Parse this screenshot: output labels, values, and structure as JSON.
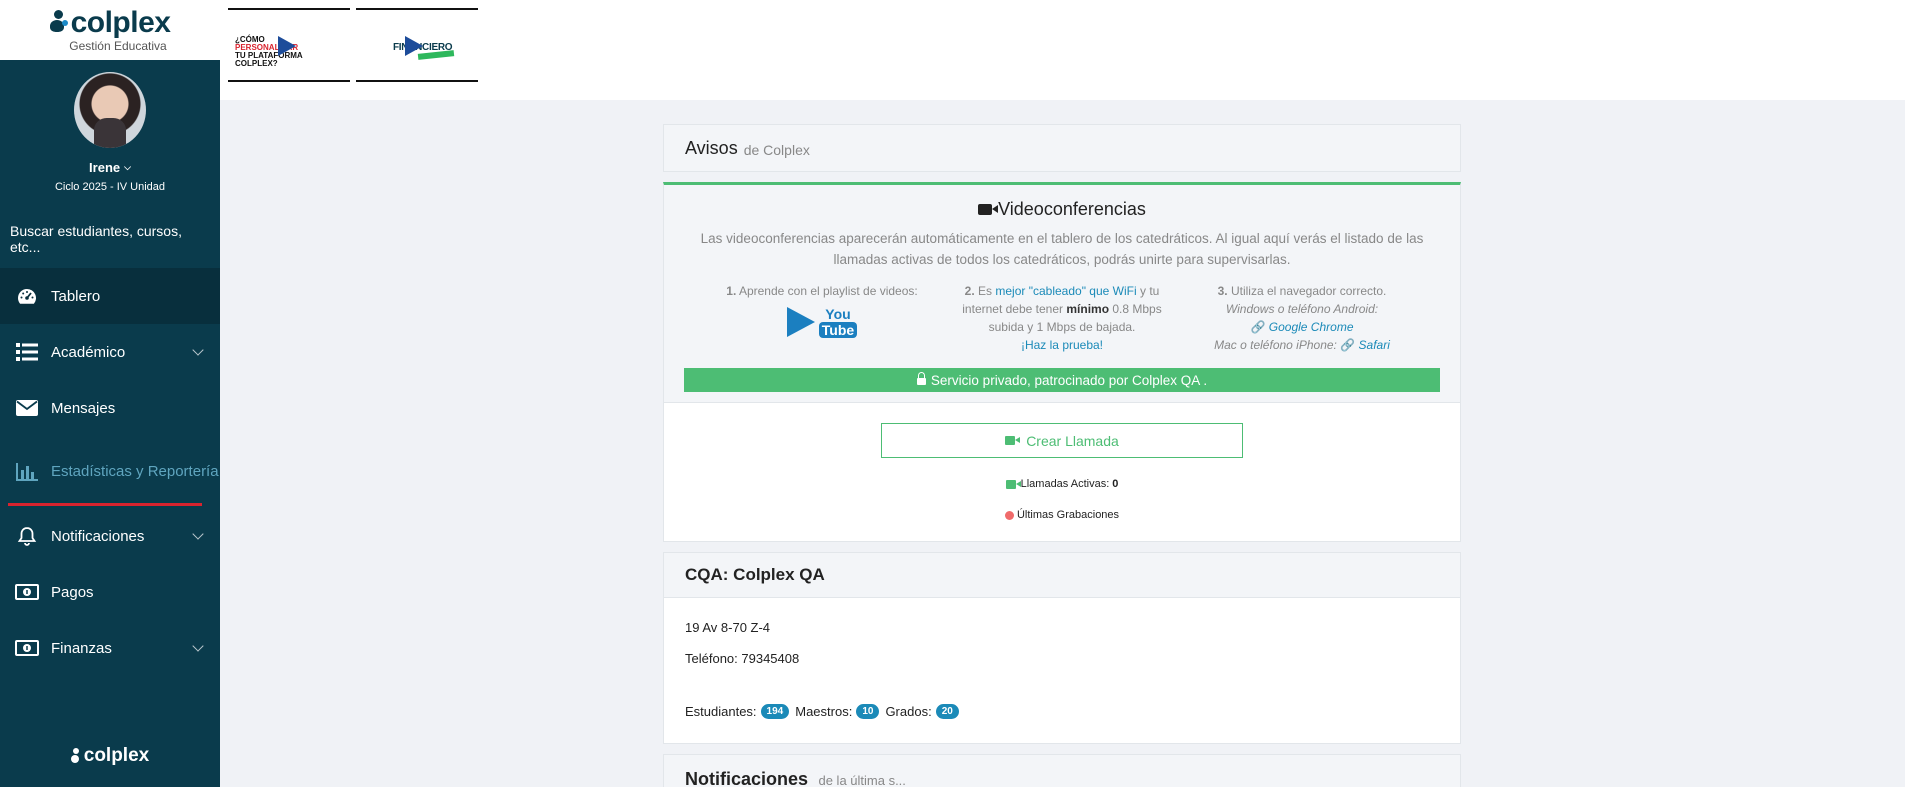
{
  "brand": {
    "name": "colplex",
    "subtitle": "Gestión Educativa",
    "footer": "colplex"
  },
  "user": {
    "name": "Irene",
    "cycle": "Ciclo 2025 - IV Unidad"
  },
  "search": {
    "placeholder": "Buscar estudiantes, cursos, etc..."
  },
  "nav": {
    "items": [
      {
        "label": "Tablero",
        "icon": "dashboard-gauge-icon",
        "active": true,
        "has_submenu": false
      },
      {
        "label": "Académico",
        "icon": "list-icon",
        "has_submenu": true
      },
      {
        "label": "Mensajes",
        "icon": "envelope-icon",
        "has_submenu": false
      },
      {
        "label": "Estadísticas y Reportería",
        "icon": "bar-chart-icon",
        "has_submenu": false
      },
      {
        "label": "Notificaciones",
        "icon": "bell-icon",
        "has_submenu": true
      },
      {
        "label": "Pagos",
        "icon": "money-bill-icon",
        "has_submenu": false
      },
      {
        "label": "Finanzas",
        "icon": "money-bill-icon",
        "has_submenu": true
      }
    ]
  },
  "promos": [
    {
      "text_lines": [
        "¿CÓMO",
        "PERSONALIZAR",
        "TU PLATAFORMA",
        "COLPLEX?"
      ]
    },
    {
      "text": "FINANCIERO"
    }
  ],
  "notices": {
    "title": "Avisos",
    "subtitle": "de Colplex"
  },
  "video": {
    "title": "Videoconferencias",
    "description": "Las videoconferencias aparecerán automáticamente en el tablero de los catedráticos. Al igual aquí verás el listado de las llamadas activas de todos los catedráticos, podrás unirte para supervisarlas.",
    "step1": {
      "num": "1.",
      "text": "Aprende con el playlist de videos:",
      "yt_top": "You",
      "yt_bottom": "Tube"
    },
    "step2": {
      "num": "2.",
      "pre": "Es",
      "link": "mejor \"cableado\" que WiFi",
      "mid": "y tu internet debe tener",
      "strong": "mínimo",
      "post": "0.8 Mbps subida y 1 Mbps de bajada.",
      "test_link": "¡Haz la prueba!"
    },
    "step3": {
      "num": "3.",
      "text": "Utiliza el navegador correcto.",
      "android": "Windows o teléfono Android:",
      "chrome": "Google Chrome",
      "iphone": "Mac o teléfono iPhone:",
      "safari": "Safari"
    },
    "private_bar": "Servicio privado, patrocinado por Colplex QA ."
  },
  "calls": {
    "create_label": "Crear Llamada",
    "active_label": "Llamadas Activas:",
    "active_count": "0",
    "recordings_label": "Últimas Grabaciones"
  },
  "school": {
    "title": "CQA: Colplex QA",
    "address": "19 Av 8-70 Z-4",
    "phone": "Teléfono: 79345408",
    "students_label": "Estudiantes:",
    "students": "194",
    "teachers_label": "Maestros:",
    "teachers": "10",
    "grades_label": "Grados:",
    "grades": "20"
  },
  "notifications": {
    "title": "Notificaciones",
    "subtitle": "de la última s..."
  },
  "colors": {
    "sidebar": "#0a3b4c",
    "accent_green": "#4dbd74",
    "accent_blue": "#1b8ab8",
    "alert_red": "#d9232e"
  }
}
